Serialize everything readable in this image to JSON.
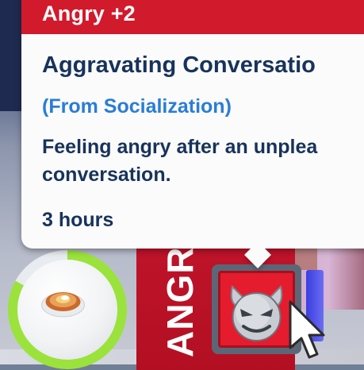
{
  "tooltip": {
    "mood_title": "Angry +2",
    "moodlet_name": "Aggravating Conversatio",
    "source": "(From Socialization)",
    "description": "Feeling angry after an unplea conversation.",
    "duration": "3 hours"
  },
  "mood_panel": {
    "label": "ANGRY",
    "moodlet_icon": "angry-devil-icon"
  },
  "need_gauge": {
    "icon": "food-pie-icon",
    "level": 0.83
  },
  "colors": {
    "angry_red": "#d11a2b",
    "title_navy": "#17335b",
    "source_blue": "#2a7dd6",
    "gauge_green": "#9be23c"
  }
}
